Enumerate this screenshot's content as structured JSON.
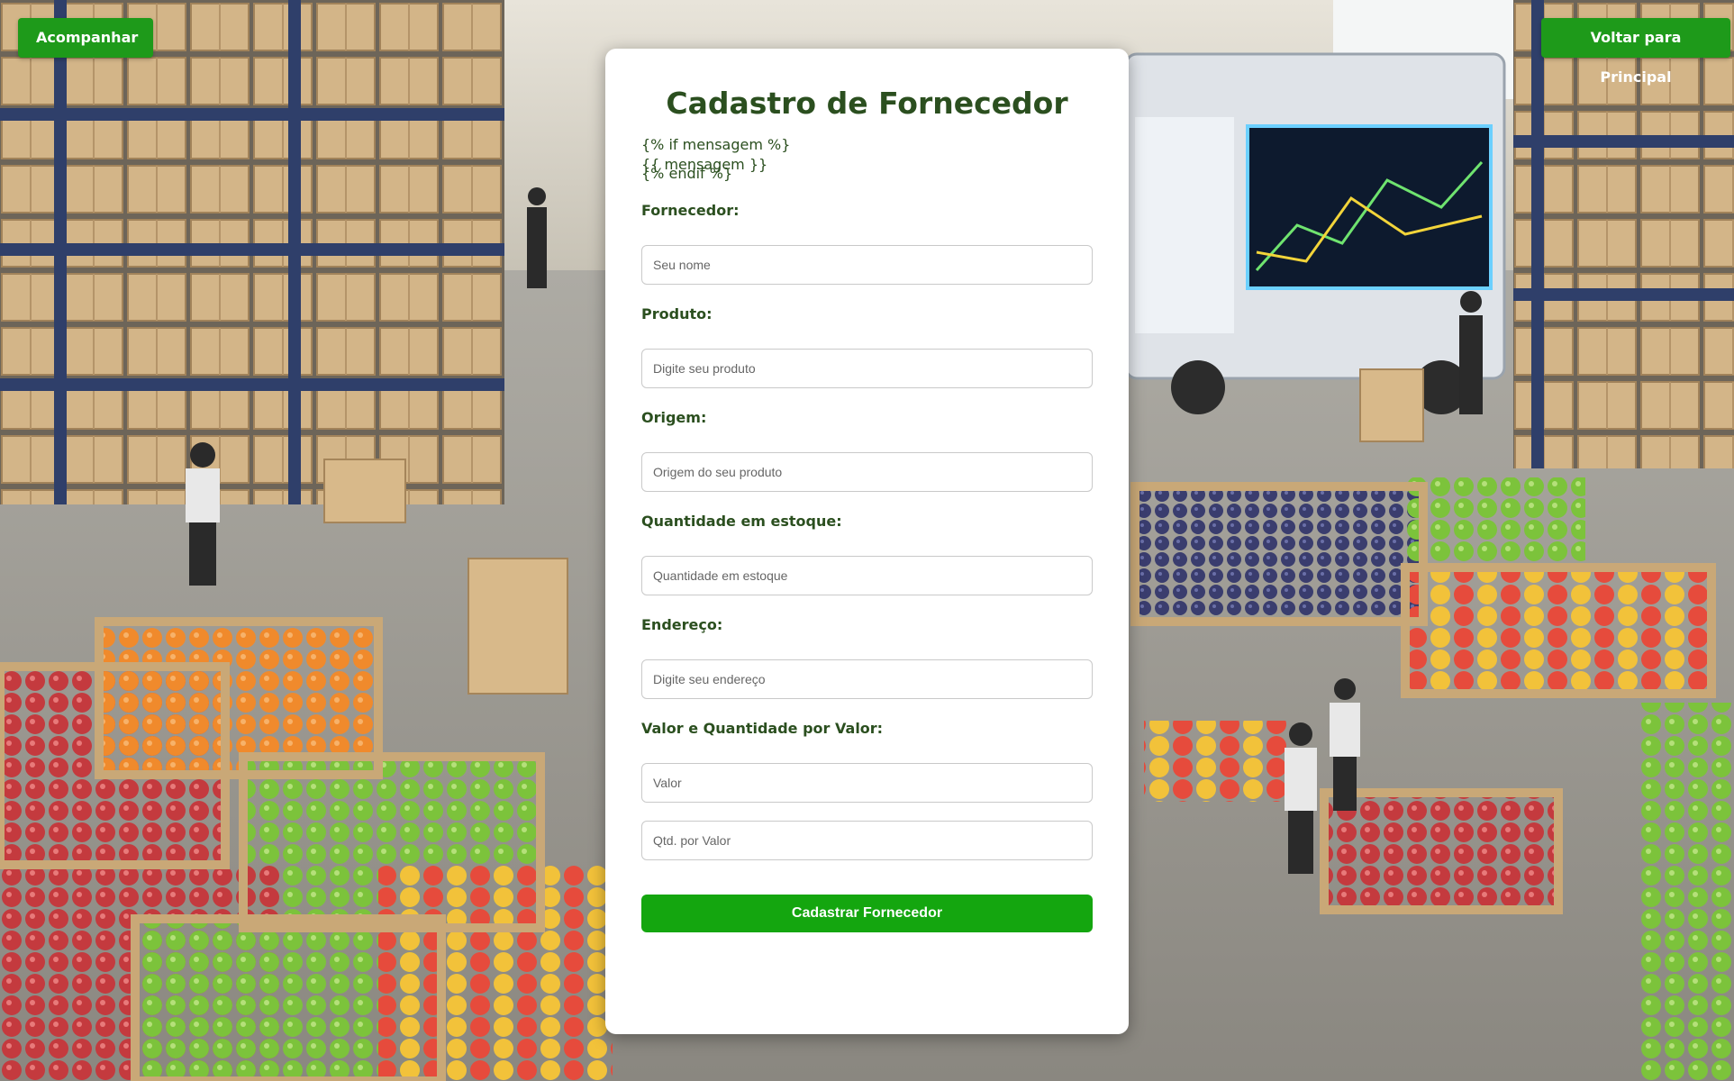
{
  "nav": {
    "left_button": "Acompanhar",
    "right_button": "Voltar para Principal"
  },
  "form": {
    "title": "Cadastro de Fornecedor",
    "template_lines": [
      "{% if mensagem %}",
      "{{ mensagem }}",
      "{% endif %}"
    ],
    "fields": [
      {
        "label": "Fornecedor:",
        "placeholder": "Seu nome"
      },
      {
        "label": "Produto:",
        "placeholder": "Digite seu produto"
      },
      {
        "label": "Origem:",
        "placeholder": "Origem do seu produto"
      },
      {
        "label": "Quantidade em estoque:",
        "placeholder": "Quantidade em estoque"
      },
      {
        "label": "Endereço:",
        "placeholder": "Digite seu endereço"
      },
      {
        "label": "Valor e Quantidade por Valor:",
        "placeholder": "Valor"
      }
    ],
    "extra_input_placeholder": "Qtd. por Valor",
    "submit_label": "Cadastrar Fornecedor"
  },
  "colors": {
    "accent_green": "#1e9a1a",
    "title_green": "#2b4f1f",
    "submit_green": "#14a60f"
  }
}
